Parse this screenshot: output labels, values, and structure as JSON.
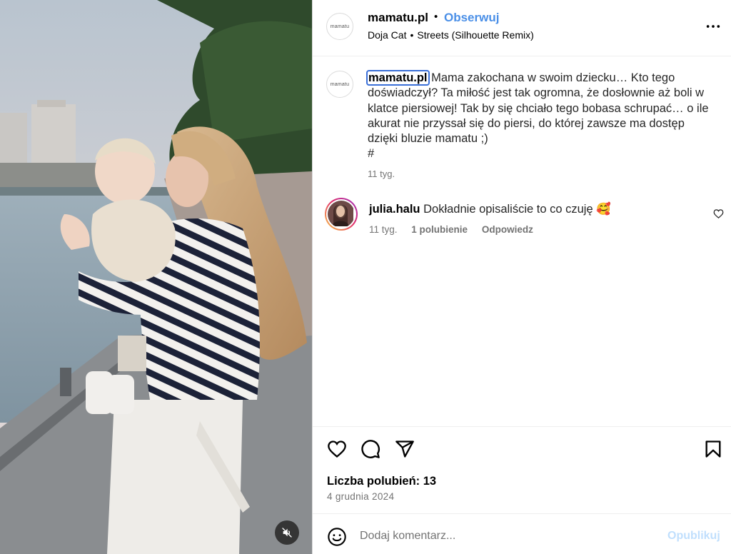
{
  "post": {
    "author": "mamatu.pl",
    "avatar_text": "mamatu",
    "follow_label": "Obserwuj",
    "separator": "•",
    "audio": {
      "artist": "Doja Cat",
      "track": "Streets (Silhouette Remix)"
    }
  },
  "caption": {
    "username": "mamatu.pl",
    "text": "Mama zakochana w swoim dziecku… Kto tego doświadczył? Ta miłość jest tak ogromna, że dosłownie aż boli w klatce piersiowej! Tak by się chciało tego bobasa schrupać… o ile akurat nie przyssał się do piersi, do której zawsze ma dostęp dzięki bluzie mamatu ;)",
    "hashtag": "#",
    "time": "11 tyg."
  },
  "comments": [
    {
      "username": "julia.halu",
      "text": "Dokładnie opisaliście to co czuję 🥰",
      "time": "11 tyg.",
      "likes": "1 polubienie",
      "reply_label": "Odpowiedz"
    }
  ],
  "stats": {
    "likes_label": "Liczba polubień: 13",
    "date": "4 grudnia 2024"
  },
  "comment_box": {
    "placeholder": "Dodaj komentarz...",
    "publish_label": "Opublikuj"
  },
  "icons": {
    "more": "more-options-icon",
    "mute": "muted-speaker-icon",
    "like": "heart-icon",
    "comment": "comment-bubble-icon",
    "share": "paper-plane-icon",
    "save": "bookmark-icon",
    "emoji": "smiley-icon"
  },
  "colors": {
    "link_blue": "#4a8fe7",
    "muted_text": "#737373",
    "publish_disabled": "#c0dffd",
    "focus_outline": "#3a6fd8"
  }
}
